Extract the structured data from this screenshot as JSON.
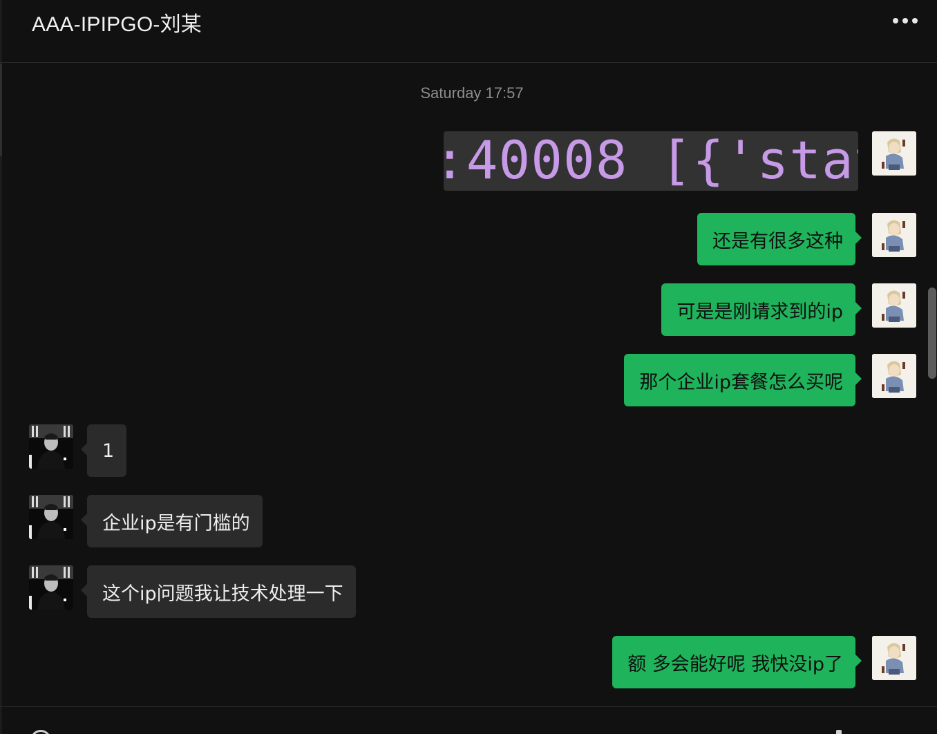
{
  "header": {
    "title": "AAA-IPIPGO-刘某",
    "more_icon": "more-horizontal-icon"
  },
  "timestamp": "Saturday 17:57",
  "colors": {
    "background": "#111111",
    "outgoing_bubble": "#1fb35b",
    "incoming_bubble": "#2b2b2b",
    "code_text": "#c79ae8"
  },
  "messages": [
    {
      "sender": "self",
      "type": "image",
      "image_text": ":40008 [{'stat"
    },
    {
      "sender": "self",
      "type": "text",
      "text": "还是有很多这种"
    },
    {
      "sender": "self",
      "type": "text",
      "text": "可是是刚请求到的ip"
    },
    {
      "sender": "self",
      "type": "text",
      "text": "那个企业ip套餐怎么买呢"
    },
    {
      "sender": "other",
      "type": "text",
      "text": "1"
    },
    {
      "sender": "other",
      "type": "text",
      "text": "企业ip是有门槛的"
    },
    {
      "sender": "other",
      "type": "text",
      "text": "这个ip问题我让技术处理一下"
    },
    {
      "sender": "self",
      "type": "text",
      "text": "额  多会能好呢 我快没ip了"
    }
  ]
}
